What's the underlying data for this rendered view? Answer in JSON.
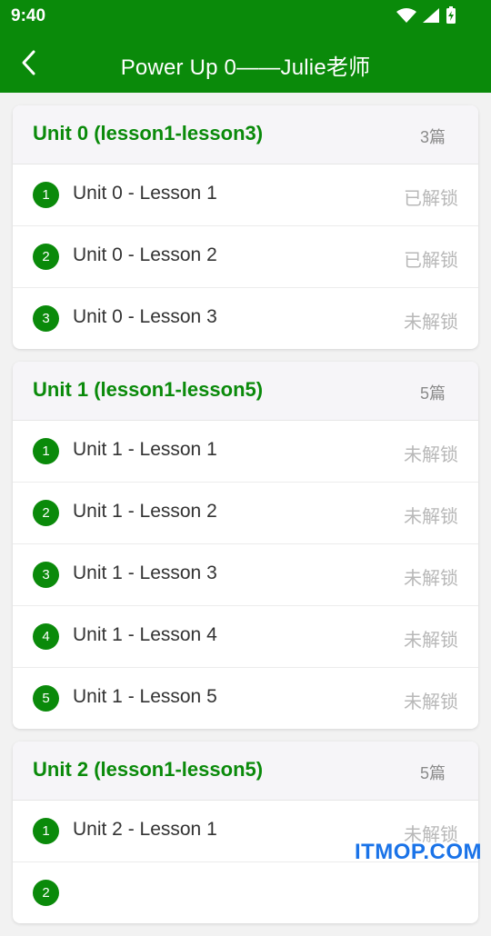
{
  "status_bar": {
    "time": "9:40"
  },
  "app_bar": {
    "title": "Power Up 0——Julie老师"
  },
  "units": [
    {
      "title": "Unit 0 (lesson1-lesson3)",
      "count": "3篇",
      "lessons": [
        {
          "num": "1",
          "label": "Unit 0 - Lesson 1",
          "state": "已解锁"
        },
        {
          "num": "2",
          "label": "Unit 0 - Lesson 2",
          "state": "已解锁"
        },
        {
          "num": "3",
          "label": "Unit 0 - Lesson 3",
          "state": "未解锁"
        }
      ]
    },
    {
      "title": "Unit 1 (lesson1-lesson5)",
      "count": "5篇",
      "lessons": [
        {
          "num": "1",
          "label": "Unit 1 - Lesson 1",
          "state": "未解锁"
        },
        {
          "num": "2",
          "label": "Unit 1 - Lesson 2",
          "state": "未解锁"
        },
        {
          "num": "3",
          "label": "Unit 1 - Lesson 3",
          "state": "未解锁"
        },
        {
          "num": "4",
          "label": "Unit 1 - Lesson 4",
          "state": "未解锁"
        },
        {
          "num": "5",
          "label": "Unit 1 - Lesson 5",
          "state": "未解锁"
        }
      ]
    },
    {
      "title": "Unit 2 (lesson1-lesson5)",
      "count": "5篇",
      "lessons": [
        {
          "num": "1",
          "label": "Unit 2 - Lesson 1",
          "state": "未解锁"
        },
        {
          "num": "2",
          "label": "",
          "state": ""
        }
      ]
    }
  ],
  "watermark": "ITMOP.COM",
  "colors": {
    "primary": "#0a8a0a",
    "locked_text": "#b8b8b8",
    "header_bg": "#f6f5f8"
  },
  "icons": [
    "wifi-icon",
    "cellular-signal-icon",
    "battery-charging-icon",
    "back-arrow-icon"
  ]
}
